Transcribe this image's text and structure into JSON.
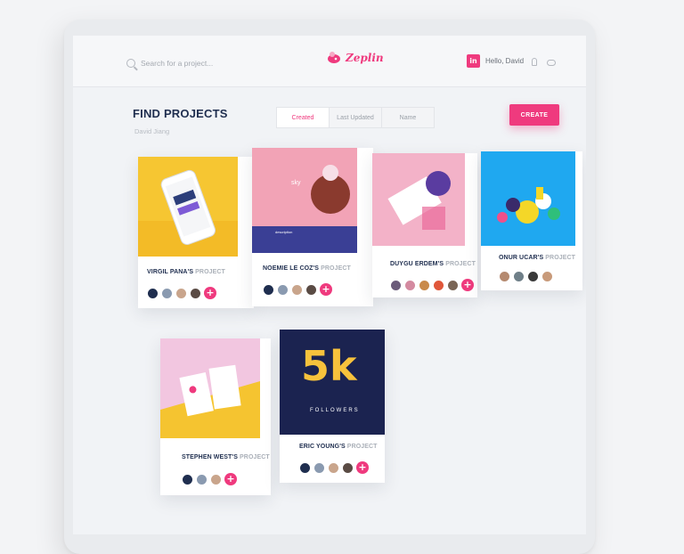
{
  "header": {
    "search_placeholder": "Search for a project...",
    "logo_text": "Zeplin",
    "user_badge": "in",
    "user_greeting": "Hello, David"
  },
  "page": {
    "title": "FIND PROJECTS",
    "subtitle": "David Jiang",
    "tabs": [
      {
        "label": "Created",
        "active": true
      },
      {
        "label": "Last Updated",
        "active": false
      },
      {
        "label": "Name",
        "active": false
      }
    ],
    "create_label": "CREATE"
  },
  "projects": [
    {
      "owner": "VIRGIL PANA'S",
      "suffix": "PROJECT"
    },
    {
      "owner": "NOEMIE LE COZ'S",
      "suffix": "PROJECT"
    },
    {
      "owner": "DUYGU ERDEM'S",
      "suffix": "PROJECT"
    },
    {
      "owner": "ONUR UCAR'S",
      "suffix": "PROJECT"
    },
    {
      "owner": "STEPHEN WEST'S",
      "suffix": "PROJECT"
    },
    {
      "owner": "ERIC YOUNG'S",
      "suffix": "PROJECT"
    }
  ],
  "thumb_texts": {
    "card2_brand": "sky",
    "card2_section": "description",
    "card6_number": "5k",
    "card6_caption": "FOLLOWERS"
  },
  "add_label": "+",
  "colors": {
    "accent": "#ef3a7e",
    "title": "#1f2e4f",
    "yellow": "#f6c632",
    "pink": "#f2a3b6",
    "blue": "#1fa8f0",
    "navy": "#1b2350"
  }
}
